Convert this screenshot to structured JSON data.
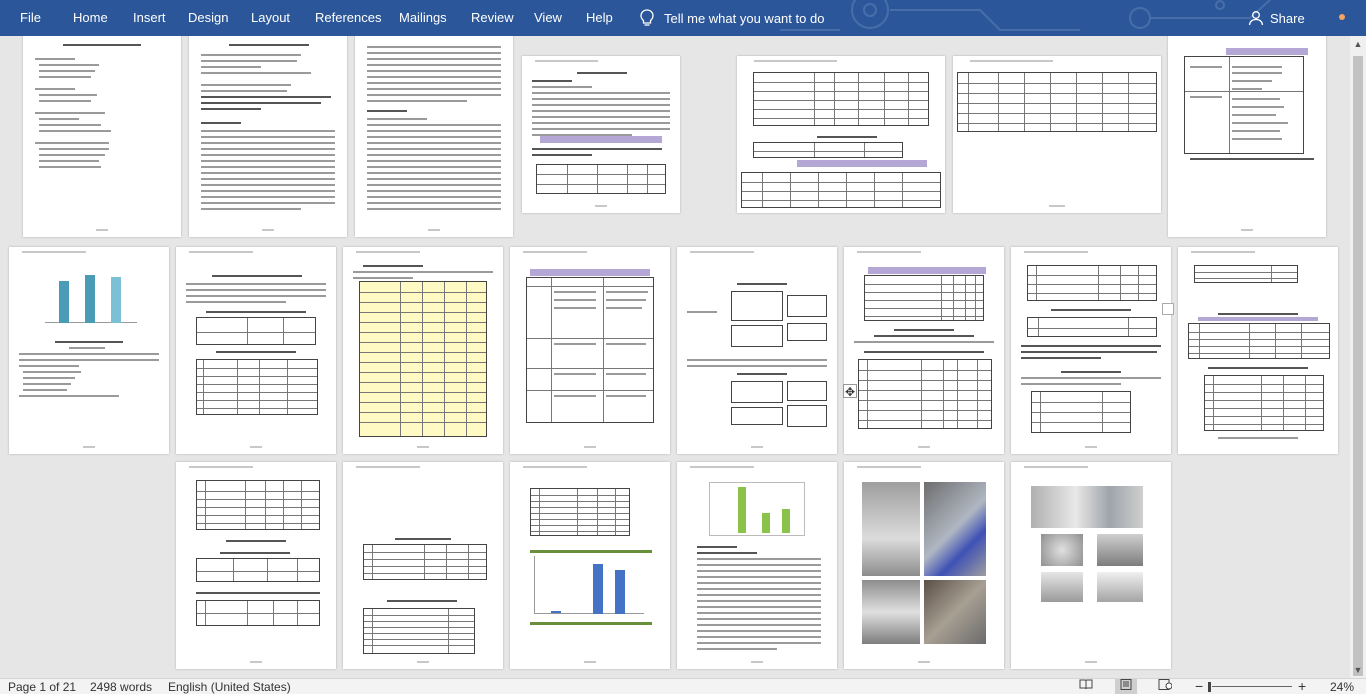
{
  "ribbon": {
    "tabs": [
      "File",
      "Home",
      "Insert",
      "Design",
      "Layout",
      "References",
      "Mailings",
      "Review",
      "View",
      "Help"
    ],
    "tell_me": "Tell me what you want to do",
    "share": "Share"
  },
  "status": {
    "page": "Page 1 of 21",
    "words": "2498 words",
    "language": "English (United States)",
    "zoom": "24%"
  },
  "colors": {
    "ribbon": "#2b579a",
    "band": "#b4a7d6",
    "chart_bar": "#4a9bb5"
  }
}
